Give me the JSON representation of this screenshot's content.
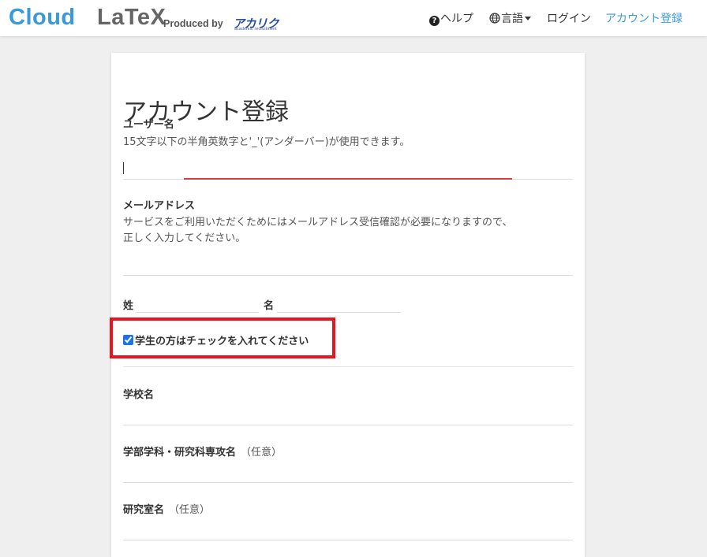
{
  "brand": {
    "cloud": "Cloud",
    "latex": "LaTeX",
    "produced_by": "Produced by",
    "logo_main": "アカリク",
    "logo_sub": "academic recruitment"
  },
  "nav": {
    "help": "ヘルプ",
    "language": "言語",
    "login": "ログイン",
    "signup": "アカウント登録"
  },
  "form": {
    "title": "アカウント登録",
    "username_label": "ユーザー名",
    "username_help": "15文字以下の半角英数字と'_'(アンダーバー)が使用できます。",
    "username_value": "",
    "email_label": "メールアドレス",
    "email_help_1": "サービスをご利用いただくためにはメールアドレス受信確認が必要になりますので、",
    "email_help_2": "正しく入力してください。",
    "email_value": "",
    "last_name_label": "姓",
    "first_name_label": "名",
    "student_checkbox_label": "学生の方はチェックを入れてください",
    "student_checked": true,
    "school_label": "学校名",
    "faculty_label": "学部学科・研究科専攻名",
    "faculty_optional": "（任意）",
    "lab_label": "研究室名",
    "lab_optional": "（任意）"
  },
  "colors": {
    "brand_blue": "#3a9ad9",
    "highlight_red": "#e8141f",
    "focus_red": "#e03a3a"
  }
}
